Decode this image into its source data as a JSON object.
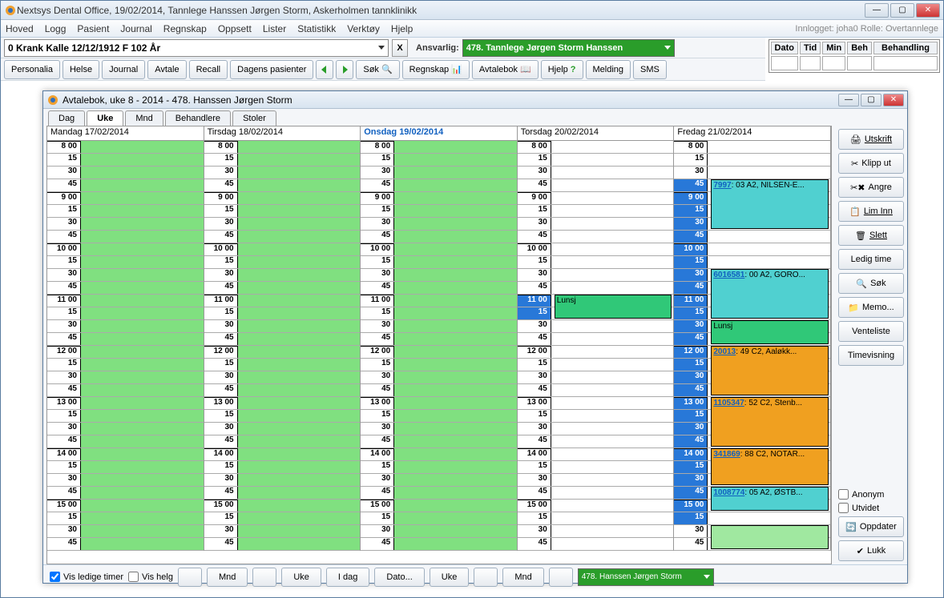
{
  "outerTitle": "Nextsys Dental Office,  19/02/2014, Tannlege Hanssen Jørgen Storm, Askerholmen tannklinikk",
  "menubar": [
    "Hoved",
    "Logg",
    "Pasient",
    "Journal",
    "Regnskap",
    "Oppsett",
    "Lister",
    "Statistikk",
    "Verktøy",
    "Hjelp"
  ],
  "loginText": "Innlogget: joha0  Rolle: Overtannlege",
  "patient": "0 Krank Kalle 12/12/1912  F  102 År",
  "ansvarligLabel": "Ansvarlig:",
  "ansvarlig": "478. Tannlege Jørgen Storm Hanssen",
  "gridHeaders": [
    "Dato",
    "Tid",
    "Min",
    "Beh",
    "Behandling"
  ],
  "toolbar2": {
    "personalia": "Personalia",
    "helse": "Helse",
    "journal": "Journal",
    "avtale": "Avtale",
    "recall": "Recall",
    "dagens": "Dagens pasienter",
    "sok": "Søk",
    "regnskap": "Regnskap",
    "avtalebok": "Avtalebok",
    "hjelp": "Hjelp",
    "melding": "Melding",
    "sms": "SMS"
  },
  "innerTitle": "Avtalebok, uke 8 - 2014  -  478. Hanssen Jørgen Storm",
  "viewTabs": [
    "Dag",
    "Uke",
    "Mnd",
    "Behandlere",
    "Stoler"
  ],
  "activeTab": "Uke",
  "days": [
    "Mandag 17/02/2014",
    "Tirsdag 18/02/2014",
    "Onsdag 19/02/2014",
    "Torsdag 20/02/2014",
    "Fredag 21/02/2014"
  ],
  "todayIndex": 2,
  "timeSlots": [
    "8 00",
    "15",
    "30",
    "45",
    "9 00",
    "15",
    "30",
    "45",
    "10 00",
    "15",
    "30",
    "45",
    "11 00",
    "15",
    "30",
    "45",
    "12 00",
    "15",
    "30",
    "45",
    "13 00",
    "15",
    "30",
    "45",
    "14 00",
    "15",
    "30",
    "45",
    "15 00",
    "15",
    "30",
    "45"
  ],
  "lunchLabel": "Lunsj",
  "thuLunchSlot": 12,
  "friAppointments": [
    {
      "start": 3,
      "span": 4,
      "cls": "cyan",
      "id": "7997",
      "txt": ": 03 A2, NILSEN-E..."
    },
    {
      "start": 10,
      "span": 4,
      "cls": "cyan",
      "id": "6016581",
      "txt": ": 00 A2, GORO..."
    },
    {
      "start": 14,
      "span": 2,
      "cls": "green",
      "label": "Lunsj"
    },
    {
      "start": 16,
      "span": 4,
      "cls": "orange",
      "id": "20013",
      "txt": ": 49 C2, Aaløkk..."
    },
    {
      "start": 20,
      "span": 4,
      "cls": "orange",
      "id": "1105347",
      "txt": ": 52 C2, Stenb..."
    },
    {
      "start": 24,
      "span": 3,
      "cls": "orange",
      "id": "341869",
      "txt": ": 88 C2, NOTAR..."
    },
    {
      "start": 27,
      "span": 2,
      "cls": "cyan",
      "id": "1008774",
      "txt": ": 05 A2, ØSTB..."
    },
    {
      "start": 30,
      "span": 2,
      "cls": "lgreen",
      "label": ""
    }
  ],
  "friBlueStart": 3,
  "friBlueEnd": 29,
  "sideButtons": {
    "utskrift": "Utskrift",
    "klipp": "Klipp ut",
    "angre": "Angre",
    "lim": "Lim Inn",
    "slett": "Slett",
    "ledig": "Ledig time",
    "sok": "Søk",
    "memo": "Memo...",
    "vente": "Venteliste",
    "timev": "Timevisning",
    "anonym": "Anonym",
    "utvidet": "Utvidet",
    "oppdater": "Oppdater",
    "lukk": "Lukk"
  },
  "bottom": {
    "visLedige": "Vis ledige timer",
    "visHelg": "Vis helg",
    "mnd": "Mnd",
    "uke": "Uke",
    "idag": "I dag",
    "dato": "Dato...",
    "practitioner": "478. Hanssen Jørgen Storm"
  }
}
